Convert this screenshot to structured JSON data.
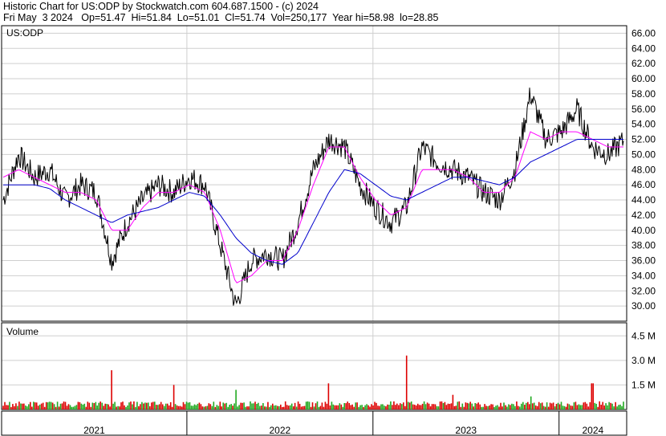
{
  "header": {
    "line1": "Historic Chart for US:ODP by Stockwatch.com 604.687.1500 - (c) 2024",
    "line2": "Fri May  3 2024   Op=51.47  Hi=51.84  Lo=51.01  Cl=51.74  Vol=250,177  Year hi=58.98  lo=28.85"
  },
  "chart_data": {
    "type": "line",
    "symbol_label": "US:ODP",
    "volume_label": "Volume",
    "ylim": [
      28,
      67
    ],
    "y_ticks": [
      "66.00",
      "64.00",
      "62.00",
      "60.00",
      "58.00",
      "56.00",
      "54.00",
      "52.00",
      "50.00",
      "48.00",
      "46.00",
      "44.00",
      "42.00",
      "40.00",
      "38.00",
      "36.00",
      "34.00",
      "32.00",
      "30.00"
    ],
    "volume_ticks": [
      "4.5 M",
      "3.0 M",
      "1.5 M"
    ],
    "x_labels": [
      "2021",
      "2022",
      "2023",
      "2024"
    ],
    "price_keypoints": {
      "x": [
        "2021-01",
        "2021-02",
        "2021-03",
        "2021-04",
        "2021-05",
        "2021-06",
        "2021-07",
        "2021-08",
        "2021-09",
        "2021-10",
        "2021-11",
        "2021-12",
        "2022-01",
        "2022-02",
        "2022-03",
        "2022-04",
        "2022-05",
        "2022-06",
        "2022-07",
        "2022-08",
        "2022-09",
        "2022-10",
        "2022-11",
        "2022-12",
        "2023-01",
        "2023-02",
        "2023-03",
        "2023-04",
        "2023-05",
        "2023-06",
        "2023-07",
        "2023-08",
        "2023-09",
        "2023-10",
        "2023-11",
        "2023-12",
        "2024-01",
        "2024-02",
        "2024-03",
        "2024-04",
        "2024-05"
      ],
      "close": [
        44,
        50,
        47,
        48,
        44,
        46,
        45,
        36,
        41,
        44,
        46,
        45,
        47,
        46,
        38,
        30,
        36,
        37,
        36,
        41,
        48,
        52,
        51,
        46,
        43,
        41,
        43,
        51,
        49,
        48,
        47,
        45,
        44,
        48,
        58,
        52,
        53,
        56,
        51,
        50,
        51.74
      ]
    },
    "ma_short_keypoints": [
      47,
      48,
      47,
      46,
      45,
      45,
      44,
      40,
      40,
      43,
      45,
      45,
      46,
      45,
      40,
      33,
      34,
      36,
      36,
      40,
      46,
      51,
      51,
      47,
      44,
      42,
      43,
      48,
      48,
      48,
      47,
      45,
      45,
      47,
      53,
      52,
      53,
      53,
      52,
      51,
      51
    ],
    "ma_long_keypoints": [
      46,
      46,
      46,
      45.5,
      44,
      43,
      42,
      41,
      42,
      42.5,
      43,
      44,
      45,
      44.5,
      42,
      39,
      37,
      36,
      35.5,
      37,
      41,
      45,
      48,
      47.5,
      46,
      44.5,
      44,
      45,
      46,
      47,
      47,
      46.5,
      46,
      47,
      49,
      50,
      51,
      52,
      52,
      52,
      52
    ],
    "volume_values_millions": [
      0.35,
      0.4,
      0.3,
      0.45,
      0.3,
      0.35,
      0.3,
      2.4,
      0.4,
      0.35,
      0.3,
      1.5,
      0.4,
      0.35,
      0.5,
      1.2,
      0.6,
      0.4,
      0.35,
      0.4,
      0.3,
      1.6,
      0.35,
      0.3,
      0.35,
      0.4,
      3.3,
      0.35,
      0.4,
      0.9,
      0.35,
      0.4,
      0.3,
      0.35,
      0.8,
      0.35,
      0.3,
      0.4,
      1.6,
      0.35,
      0.25
    ],
    "colors": {
      "price": "#000000",
      "ma_short": "#ff00ff",
      "ma_long": "#0000cc",
      "volume_up": "#22aa22",
      "volume_down": "#dd0000"
    },
    "grid": true
  }
}
